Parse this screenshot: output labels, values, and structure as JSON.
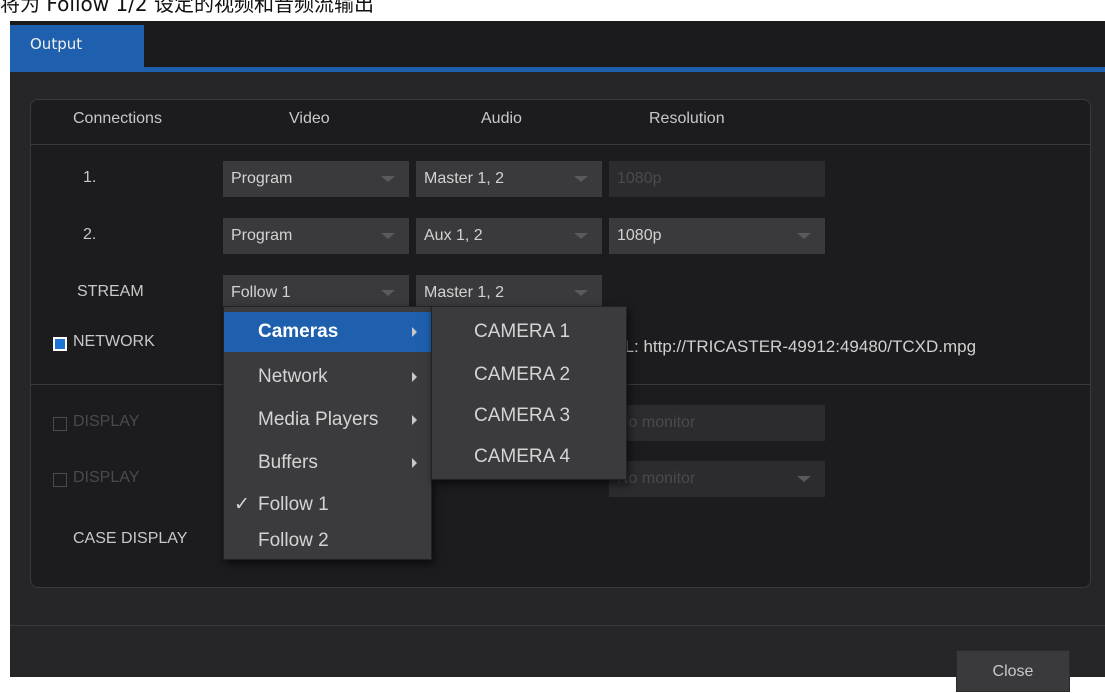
{
  "caption": "将为 Follow 1/2 设定的视频和音频流输出",
  "tabs": [
    {
      "label": "Output"
    }
  ],
  "columns": {
    "connections": "Connections",
    "video": "Video",
    "audio": "Audio",
    "resolution": "Resolution"
  },
  "rows": {
    "r1": {
      "label": "1.",
      "video": "Program",
      "audio": "Master 1, 2",
      "resolution": "1080p"
    },
    "r2": {
      "label": "2.",
      "video": "Program",
      "audio": "Aux 1, 2",
      "resolution": "1080p"
    },
    "stream": {
      "label": "STREAM",
      "video": "Follow 1",
      "audio": "Master 1, 2"
    },
    "network": {
      "label": "NETWORK",
      "checked": true,
      "url": "URL: http://TRICASTER-49912:49480/TCXD.mpg"
    },
    "display1": {
      "label": "DISPLAY",
      "checked": false,
      "monitor": "No monitor"
    },
    "display2": {
      "label": "DISPLAY",
      "checked": false,
      "monitor": "No monitor"
    },
    "case_display": {
      "label": "CASE DISPLAY"
    }
  },
  "source_menu": {
    "items": [
      {
        "label": "Cameras",
        "submenu": true,
        "active": true
      },
      {
        "label": "Network",
        "submenu": true
      },
      {
        "label": "Media Players",
        "submenu": true
      },
      {
        "label": "Buffers",
        "submenu": true
      },
      {
        "label": "Follow 1",
        "checked": true
      },
      {
        "label": "Follow 2"
      }
    ],
    "check_mark": "✓"
  },
  "camera_submenu": {
    "items": [
      "CAMERA 1",
      "CAMERA 2",
      "CAMERA 3",
      "CAMERA 4"
    ]
  },
  "footer": {
    "close_label": "Close"
  },
  "colors": {
    "accent": "#1e5fae",
    "background": "#262629",
    "panel": "#1c1c1f"
  }
}
